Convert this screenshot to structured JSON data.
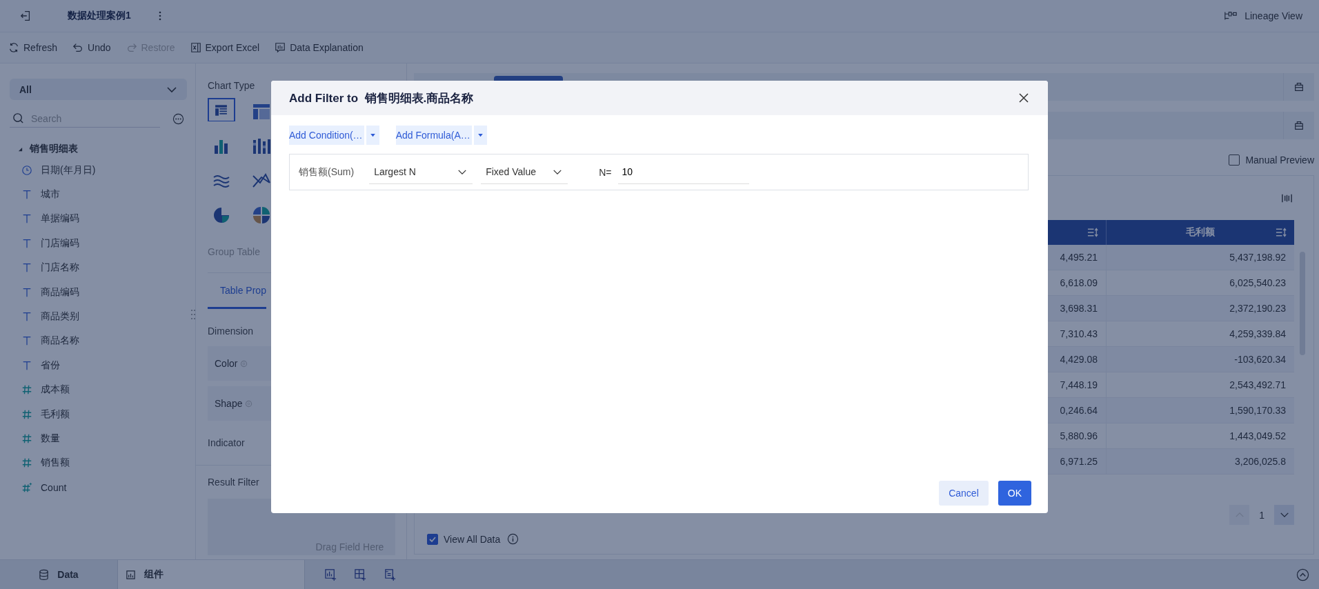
{
  "top_bar": {
    "title": "数据处理案例1",
    "lineage_view": "Lineage View"
  },
  "toolbar": [
    {
      "label": "Refresh",
      "kind": "refresh",
      "disabled": false
    },
    {
      "label": "Undo",
      "kind": "undo",
      "disabled": false
    },
    {
      "label": "Restore",
      "kind": "redo",
      "disabled": true
    },
    {
      "label": "Export Excel",
      "kind": "excel",
      "disabled": false
    },
    {
      "label": "Data Explanation",
      "kind": "explain",
      "disabled": false
    }
  ],
  "data_panel": {
    "scope": "All",
    "search": {
      "placeholder": "Search"
    },
    "tree": [
      {
        "label": "销售明细表",
        "expanded": true,
        "children": [
          {
            "label": "日期(年月日)",
            "kind": "date"
          },
          {
            "label": "城市",
            "kind": "text"
          },
          {
            "label": "单据编码",
            "kind": "text"
          },
          {
            "label": "门店编码",
            "kind": "text"
          },
          {
            "label": "门店名称",
            "kind": "text"
          },
          {
            "label": "商品编码",
            "kind": "text"
          },
          {
            "label": "商品类别",
            "kind": "text"
          },
          {
            "label": "商品名称",
            "kind": "text"
          },
          {
            "label": "省份",
            "kind": "text"
          },
          {
            "label": "成本额",
            "kind": "number"
          },
          {
            "label": "毛利额",
            "kind": "number"
          },
          {
            "label": "数量",
            "kind": "number"
          },
          {
            "label": "销售额",
            "kind": "number"
          },
          {
            "label": "Count",
            "kind": "count"
          }
        ]
      }
    ]
  },
  "config_panel": {
    "chart_type_label": "Chart Type",
    "chart_types": [
      {
        "kind": "table",
        "selected": true
      },
      {
        "kind": "cross",
        "selected": false
      },
      {
        "kind": "bar",
        "selected": false
      },
      {
        "kind": "stacked",
        "selected": false
      },
      {
        "kind": "wave",
        "selected": false
      },
      {
        "kind": "polyline",
        "selected": false
      },
      {
        "kind": "pie",
        "selected": false
      },
      {
        "kind": "split-pie",
        "selected": false
      }
    ],
    "chart_name": "Group Table",
    "tab": {
      "label": "Table Prop",
      "selected": true
    },
    "dimension_label": "Dimension",
    "channels": [
      "Color",
      "Shape"
    ],
    "indicator_label": "Indicator",
    "result_filter": {
      "label": "Result Filter",
      "placeholder": "Drag Field Here"
    }
  },
  "preview": {
    "manual_preview": {
      "label": "Manual Preview",
      "checked": false
    },
    "table": {
      "columns": [
        {
          "sortable": true
        },
        {
          "label": "毛利额",
          "sortable": true
        }
      ],
      "rows": [
        [
          "4,495.21",
          "5,437,198.92"
        ],
        [
          "6,618.09",
          "6,025,540.23"
        ],
        [
          "3,698.31",
          "2,372,190.23"
        ],
        [
          "7,310.43",
          "4,259,339.84"
        ],
        [
          "4,429.08",
          "-103,620.34"
        ],
        [
          "7,448.19",
          "2,543,492.71"
        ],
        [
          "0,246.64",
          "1,590,170.33"
        ],
        [
          "5,880.96",
          "1,443,049.52"
        ],
        [
          "6,971.25",
          "3,206,025.8"
        ]
      ]
    },
    "pagination": {
      "page": "1",
      "prev_disabled": true
    },
    "view_all_data": {
      "label": "View All Data",
      "checked": true
    }
  },
  "bottom_bar": {
    "tabs": [
      {
        "label": "Data",
        "kind": "data",
        "selected": false
      },
      {
        "label": "组件",
        "kind": "component",
        "selected": true
      }
    ]
  },
  "dialog": {
    "title_prefix": "Add Filter to",
    "title_field": "销售明细表.商品名称",
    "add_buttons": [
      "Add Condition(…",
      "Add Formula(A…"
    ],
    "condition": {
      "field": "销售额(Sum)",
      "operator": "Largest N",
      "value_type": "Fixed Value",
      "n_label": "N=",
      "n_value": "10"
    },
    "buttons": [
      {
        "label": "Cancel",
        "kind": "secondary"
      },
      {
        "label": "OK",
        "kind": "primary"
      }
    ]
  }
}
